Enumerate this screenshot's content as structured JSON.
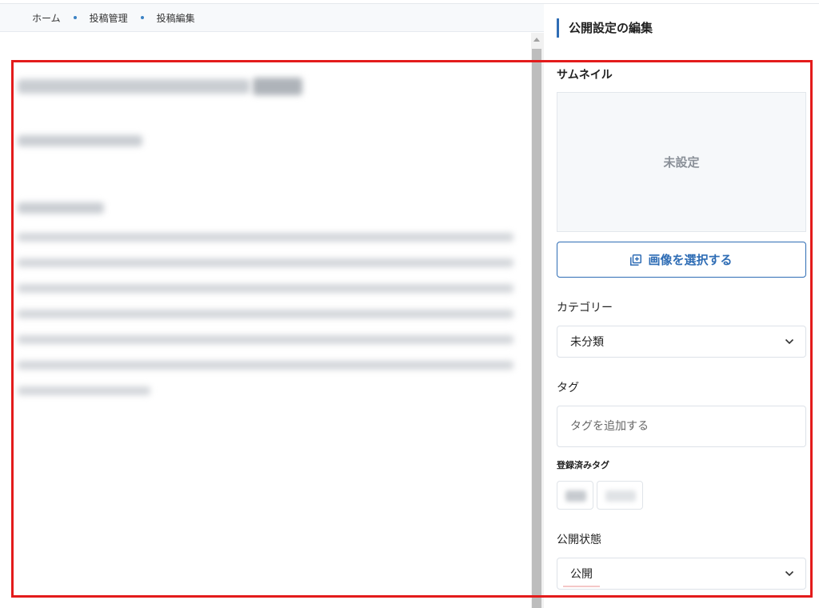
{
  "breadcrumb": [
    "ホーム",
    "投稿管理",
    "投稿編集"
  ],
  "panel": {
    "title": "公開設定の編集",
    "thumbnail": {
      "label": "サムネイル",
      "empty_text": "未設定",
      "select_button": "画像を選択する"
    },
    "category": {
      "label": "カテゴリー",
      "value": "未分類"
    },
    "tags": {
      "label": "タグ",
      "input_placeholder": "タグを追加する",
      "registered_label": "登録済みタグ"
    },
    "status": {
      "label": "公開状態",
      "value": "公開"
    }
  },
  "colors": {
    "accent": "#2f6db5",
    "annotation": "#e31b1b"
  }
}
